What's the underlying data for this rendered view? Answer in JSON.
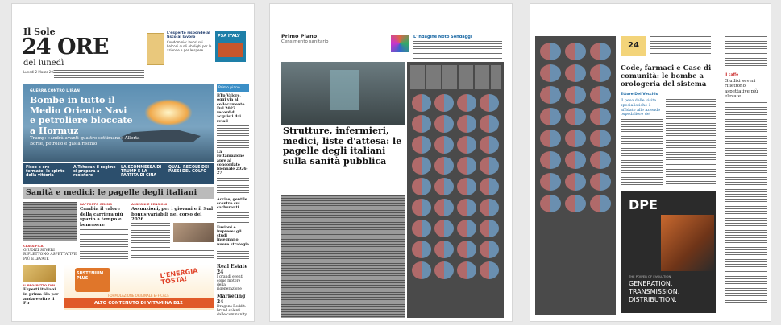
{
  "page1": {
    "masthead_top": "Il Sole",
    "masthead_main": "24 ORE",
    "masthead_sub": "del lunedì",
    "dateline": "Lunedì 2 Marzo 2026",
    "promo_label": "L'esperto risponde",
    "promo_text": "L'esperto risponde al fisco al lavoro",
    "promo_body": "Condominio: lavori sui balconi quali obblighi per le aziende e per le spese",
    "hero_kicker": "GUERRA CONTRO L'IRAN",
    "hero_title": "Bombe in tutto il Medio Oriente Navi e petroliere bloccate a Hormuz",
    "hero_sub": "Trump: «andrà avanti quattro settimane» Allerta Borse, petrolio e gas a rischio",
    "teaser_1": "Fisco e ore fermate: le spinte della vittoria",
    "teaser_2": "A Teheran il regime si prepara a resistere",
    "teaser_3": "LA SCOMMESSA DI TRUMP E LA PARTITA DI CINA",
    "teaser_4": "QUALI REGOLE DEI PAESI DEL GOLFO",
    "section_title": "Sanità e medici: le pagelle degli italiani",
    "col_a_kicker": "RAPPORTO CENSIS",
    "col_a_title": "Cambia il valore della carriera più spazio a tempo e benessere",
    "col_b_kicker": "ASSEGNI E PENSIONI",
    "col_b_title": "Assunzioni, per i giovani e il Sud bonus variabili nel corso del 2026",
    "side_label": "PSA ITALY",
    "side_tag": "Primo piano",
    "side_1_title": "BTp Valore, oggi via al collocamento Dal 2023 record di acquisti dai retail",
    "side_2_title": "La rottamazione apre al concordato biennale 2026-27",
    "side_3_title": "Accise, gentile scontro sui carburanti",
    "side_4_title": "Fusioni e imprese: gli studi insegnano nuove strategie",
    "side_5_title": "Real Estate 24",
    "side_5_body": "I grandi eventi come motore della rigenerazione",
    "side_6_title": "Marketing 24",
    "side_6_body": "Dragons Reddit: brand solenti dalle community",
    "small_label": "CLASSIFICA",
    "small_title": "GIUDIZI SEVERI RIFLETTONO ASPETTATIVE PIÙ ELEVATE",
    "bottom_label": "IL PROSPETTO TARI",
    "bottom_title": "Esperti italiani in prima fila per andare oltre il Pir",
    "ad_brand": "SUSTENIUM PLUS",
    "ad_slogan": "L'ENERGIA TOSTA!",
    "ad_banner": "ALTO CONTENUTO DI VITAMINA B12",
    "ad_banner_top": "FORMULAZIONE ORIGINALE EFFICACE"
  },
  "page2": {
    "section": "Primo Piano",
    "subsection": "Censimento sanitario",
    "survey_label": "L'indagine Noto Sondaggi",
    "main_title": "Strutture, infermieri, medici, liste d'attesa: le pagelle degli italiani sulla sanità pubblica"
  },
  "page3": {
    "title": "Code, farmaci e Case di comunità: le bombe a orologeria del sistema",
    "byline": "Ettore Del Vecchio",
    "pull_quote": "Il peso delle visite specialistiche è affidato alle aziende ospedaliere del territorio",
    "side_title": "Giudizi severi riflettono aspettative più elevate",
    "side_section": "Il caffè",
    "ad_brand": "DPE",
    "ad_tagline": "THE POWER OF EVOLUTION",
    "ad_line1": "GENERATION.",
    "ad_line2": "TRANSMISSION.",
    "ad_line3": "DISTRIBUTION."
  }
}
